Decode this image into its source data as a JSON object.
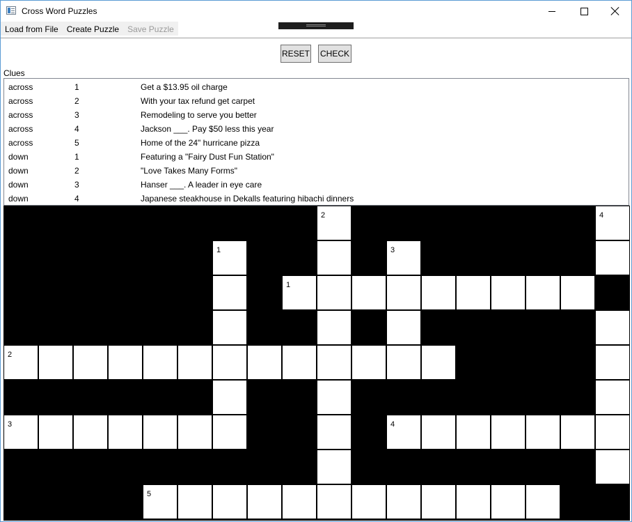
{
  "window": {
    "title": "Cross Word Puzzles"
  },
  "menu": {
    "load": "Load from File",
    "create": "Create Puzzle",
    "save": "Save Puzzle"
  },
  "buttons": {
    "reset": "RESET",
    "check": "CHECK"
  },
  "clues_label": "Clues",
  "clues": [
    {
      "direction": "across",
      "number": "1",
      "text": "Get a $13.95 oil charge"
    },
    {
      "direction": "across",
      "number": "2",
      "text": "With your tax refund get carpet"
    },
    {
      "direction": "across",
      "number": "3",
      "text": "Remodeling to serve you better"
    },
    {
      "direction": "across",
      "number": "4",
      "text": "Jackson ___. Pay $50 less this year"
    },
    {
      "direction": "across",
      "number": "5",
      "text": "Home of the 24\" hurricane pizza"
    },
    {
      "direction": "down",
      "number": "1",
      "text": "Featuring a \"Fairy Dust Fun Station\""
    },
    {
      "direction": "down",
      "number": "2",
      "text": "\"Love Takes Many Forms\""
    },
    {
      "direction": "down",
      "number": "3",
      "text": "Hanser ___. A leader in eye care"
    },
    {
      "direction": "down",
      "number": "4",
      "text": "Japanese steakhouse in Dekalls featuring hibachi dinners"
    }
  ],
  "grid": {
    "rows": 9,
    "cols": 18,
    "cells": [
      ".........2.......4",
      "......1..#.3.....#",
      "......#.1########",
      "......#..#.#.....#",
      "2############....#",
      "......#..#.......#",
      "3######..#.4######",
      ".........#.......#",
      "....5###########.."
    ]
  }
}
